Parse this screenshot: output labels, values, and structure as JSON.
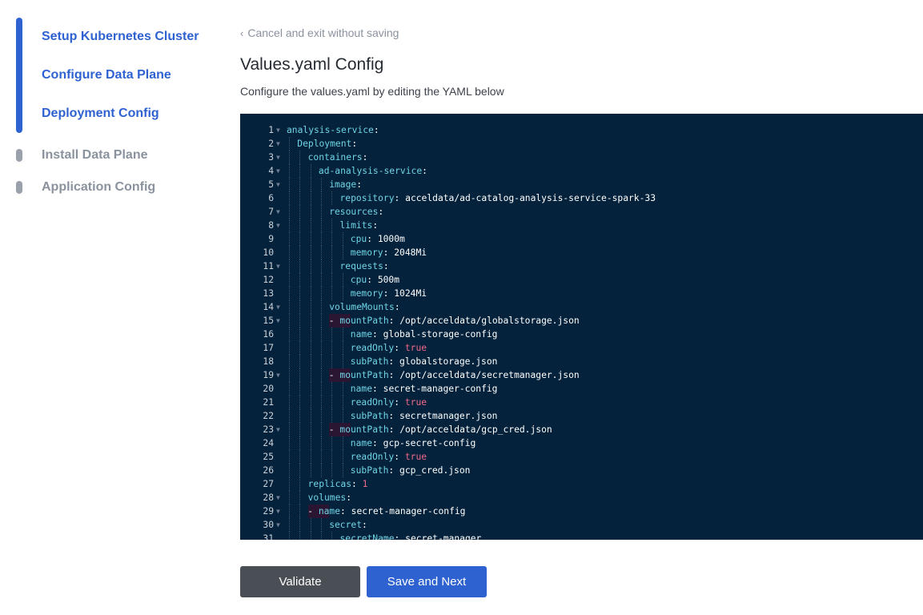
{
  "steps": [
    {
      "label": "Setup Kubernetes Cluster",
      "state": "done"
    },
    {
      "label": "Configure Data Plane",
      "state": "done"
    },
    {
      "label": "Deployment Config",
      "state": "done"
    },
    {
      "label": "Install Data Plane",
      "state": "todo"
    },
    {
      "label": "Application Config",
      "state": "todo"
    }
  ],
  "header": {
    "cancel_label": "Cancel and exit without saving",
    "title": "Values.yaml Config",
    "subtitle": "Configure the values.yaml by editing the YAML below"
  },
  "editor": {
    "lines": [
      {
        "n": "1",
        "indent": 0,
        "fold": true,
        "key": "analysis-service"
      },
      {
        "n": "2",
        "indent": 1,
        "fold": true,
        "key": "Deployment"
      },
      {
        "n": "3",
        "indent": 2,
        "fold": true,
        "key": "containers"
      },
      {
        "n": "4",
        "indent": 3,
        "fold": true,
        "key": "ad-analysis-service"
      },
      {
        "n": "5",
        "indent": 4,
        "fold": true,
        "key": "image"
      },
      {
        "n": "6",
        "indent": 5,
        "fold": false,
        "key": "repository",
        "value": "acceldata/ad-catalog-analysis-service-spark-33"
      },
      {
        "n": "7",
        "indent": 4,
        "fold": true,
        "key": "resources"
      },
      {
        "n": "8",
        "indent": 5,
        "fold": true,
        "key": "limits"
      },
      {
        "n": "9",
        "indent": 6,
        "fold": false,
        "key": "cpu",
        "value": "1000m"
      },
      {
        "n": "10",
        "indent": 6,
        "fold": false,
        "key": "memory",
        "value": "2048Mi"
      },
      {
        "n": "11",
        "indent": 5,
        "fold": true,
        "key": "requests"
      },
      {
        "n": "12",
        "indent": 6,
        "fold": false,
        "key": "cpu",
        "value": "500m"
      },
      {
        "n": "13",
        "indent": 6,
        "fold": false,
        "key": "memory",
        "value": "1024Mi"
      },
      {
        "n": "14",
        "indent": 4,
        "fold": true,
        "key": "volumeMounts"
      },
      {
        "n": "15",
        "indent": 5,
        "fold": true,
        "dash": true,
        "key": "mountPath",
        "value": "/opt/acceldata/globalstorage.json"
      },
      {
        "n": "16",
        "indent": 6,
        "fold": false,
        "key": "name",
        "value": "global-storage-config"
      },
      {
        "n": "17",
        "indent": 6,
        "fold": false,
        "key": "readOnly",
        "value": "true",
        "vtype": "bool"
      },
      {
        "n": "18",
        "indent": 6,
        "fold": false,
        "key": "subPath",
        "value": "globalstorage.json"
      },
      {
        "n": "19",
        "indent": 5,
        "fold": true,
        "dash": true,
        "key": "mountPath",
        "value": "/opt/acceldata/secretmanager.json"
      },
      {
        "n": "20",
        "indent": 6,
        "fold": false,
        "key": "name",
        "value": "secret-manager-config"
      },
      {
        "n": "21",
        "indent": 6,
        "fold": false,
        "key": "readOnly",
        "value": "true",
        "vtype": "bool"
      },
      {
        "n": "22",
        "indent": 6,
        "fold": false,
        "key": "subPath",
        "value": "secretmanager.json"
      },
      {
        "n": "23",
        "indent": 5,
        "fold": true,
        "dash": true,
        "key": "mountPath",
        "value": "/opt/acceldata/gcp_cred.json"
      },
      {
        "n": "24",
        "indent": 6,
        "fold": false,
        "key": "name",
        "value": "gcp-secret-config"
      },
      {
        "n": "25",
        "indent": 6,
        "fold": false,
        "key": "readOnly",
        "value": "true",
        "vtype": "bool"
      },
      {
        "n": "26",
        "indent": 6,
        "fold": false,
        "key": "subPath",
        "value": "gcp_cred.json"
      },
      {
        "n": "27",
        "indent": 2,
        "fold": false,
        "key": "replicas",
        "value": "1",
        "vtype": "num"
      },
      {
        "n": "28",
        "indent": 2,
        "fold": true,
        "key": "volumes"
      },
      {
        "n": "29",
        "indent": 3,
        "fold": true,
        "dash": true,
        "key": "name",
        "value": "secret-manager-config"
      },
      {
        "n": "30",
        "indent": 4,
        "fold": true,
        "key": "secret"
      },
      {
        "n": "31",
        "indent": 5,
        "fold": false,
        "key": "secretName",
        "value": "secret-manager"
      }
    ]
  },
  "actions": {
    "validate_label": "Validate",
    "save_label": "Save and Next"
  },
  "colors": {
    "accent": "#2f62d1",
    "editor_bg": "#04223b",
    "yaml_key": "#6fd6e7",
    "yaml_literal": "#f06a8a"
  },
  "icons": {
    "cancel": "chevron-left-icon",
    "fold": "fold-arrow-icon"
  }
}
